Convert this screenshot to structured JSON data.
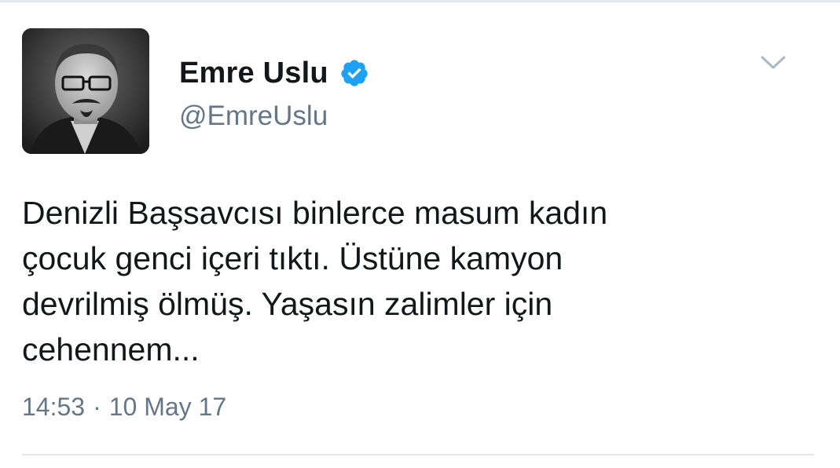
{
  "tweet": {
    "author": {
      "display_name": "Emre Uslu",
      "handle": "@EmreUslu",
      "verified": true,
      "avatar": "avatar-photo-grayscale"
    },
    "text": "Denizli Başsavcısı binlerce masum kadın\nçocuk genci içeri tıktı. Üstüne kamyon\ndevrilmiş ölmüş. Yaşasın zalimler için\ncehennem...",
    "time": "14:53",
    "separator": "·",
    "date": "10 May 17",
    "menu_icon": "chevron-down-icon"
  },
  "colors": {
    "text_primary": "#14171a",
    "text_secondary": "#657786",
    "verified_blue": "#1da1f2",
    "divider": "#e1e8ed",
    "caret": "#aab8c2"
  }
}
